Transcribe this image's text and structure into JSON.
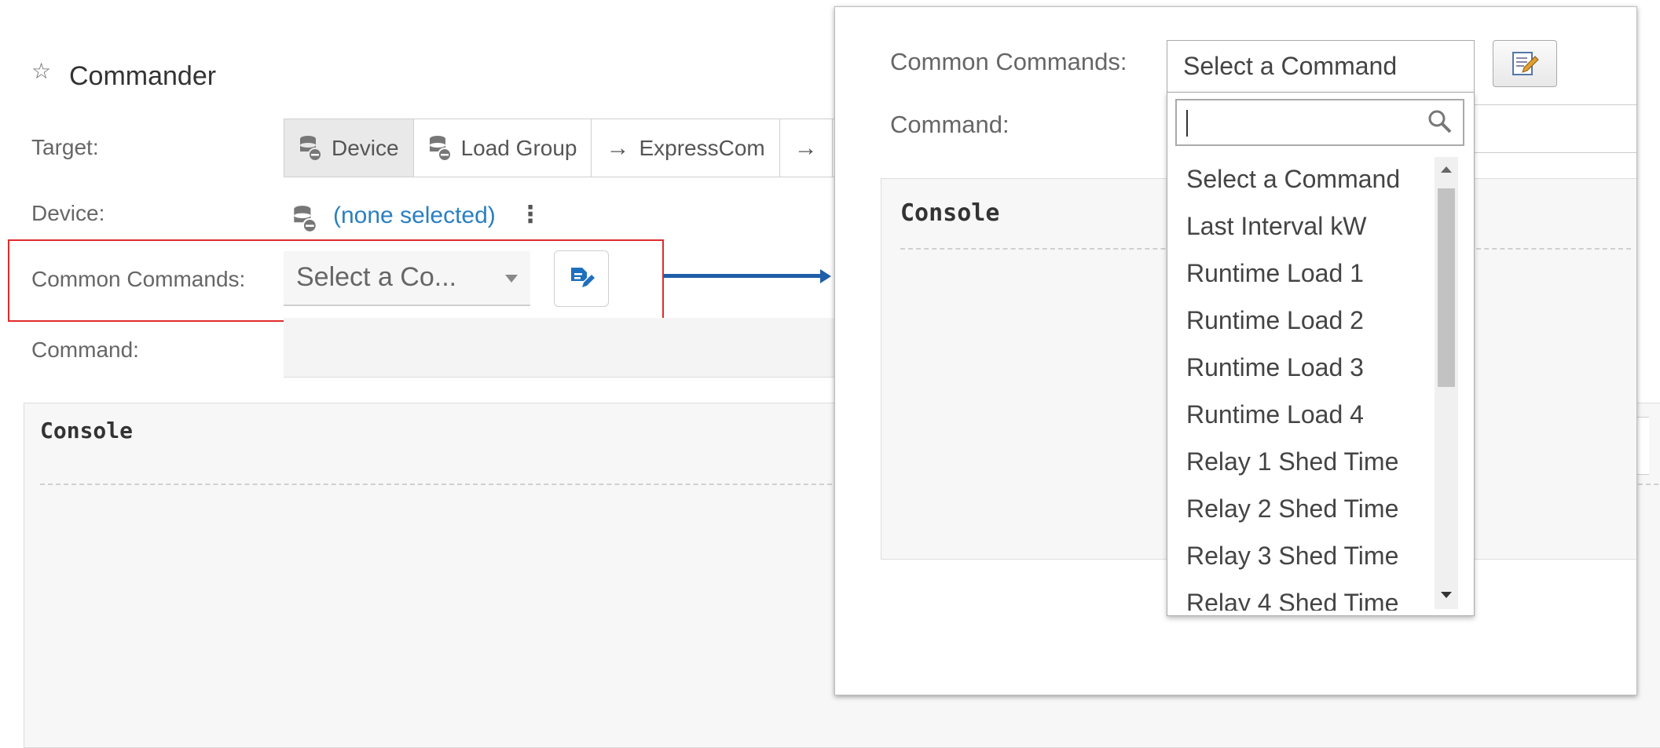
{
  "header": {
    "title": "Commander"
  },
  "form": {
    "target_label": "Target:",
    "target_options": [
      "Device",
      "Load Group",
      "ExpressCom"
    ],
    "device_label": "Device:",
    "device_value": "(none selected)",
    "common_commands_label": "Common Commands:",
    "common_commands_value": "Select a Co...",
    "command_label": "Command:"
  },
  "console": {
    "title": "Console"
  },
  "zoom_popup": {
    "common_commands_label": "Common Commands:",
    "command_label": "Command:",
    "select_value": "Select a Command",
    "console_title": "Console",
    "dropdown_options": [
      "Select a Command",
      "Last Interval kW",
      "Runtime Load 1",
      "Runtime Load 2",
      "Runtime Load 3",
      "Runtime Load 4",
      "Relay 1 Shed Time",
      "Relay 2 Shed Time",
      "Relay 3 Shed Time",
      "Relay 4 Shed Time"
    ]
  },
  "colors": {
    "link": "#2a7fc1",
    "highlight_box": "#e02b2b",
    "callout_arrow": "#1f5ea8",
    "edit_icon": "#1f6fbf"
  },
  "icons": [
    "star-icon",
    "database-icon",
    "arrow-right-icon",
    "more-vertical-icon",
    "edit-icon",
    "search-icon"
  ]
}
